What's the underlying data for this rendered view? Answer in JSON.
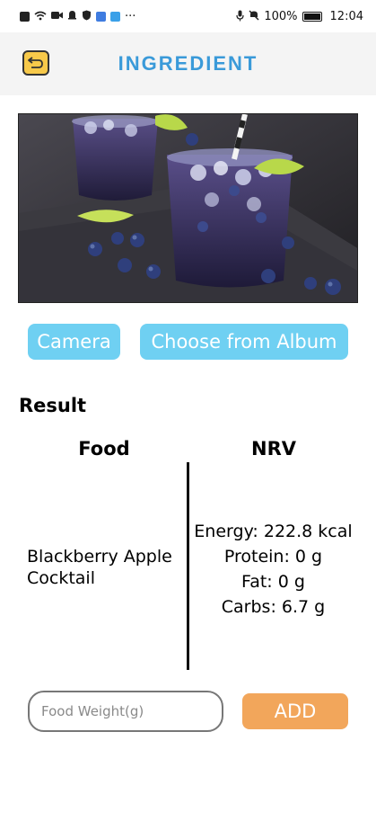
{
  "status_bar": {
    "battery_percent": "100%",
    "time": "12:04",
    "more_indicator": "···"
  },
  "header": {
    "title": "INGREDIENT",
    "title_color": "#3a9ad9",
    "back_icon": "return-arrow-icon"
  },
  "buttons": {
    "camera": "Camera",
    "album": "Choose from Album",
    "add": "ADD",
    "blue_color": "#6fd0f2",
    "orange_color": "#f2a65b"
  },
  "result": {
    "label": "Result",
    "col_food": "Food",
    "col_nrv": "NRV",
    "food_name": "Blackberry Apple Cocktail",
    "nrv": {
      "energy": "Energy: 222.8 kcal",
      "protein": "Protein: 0 g",
      "fat": "Fat: 0 g",
      "carbs": "Carbs: 6.7 g"
    }
  },
  "weight_input": {
    "placeholder": "Food Weight(g)",
    "value": ""
  }
}
